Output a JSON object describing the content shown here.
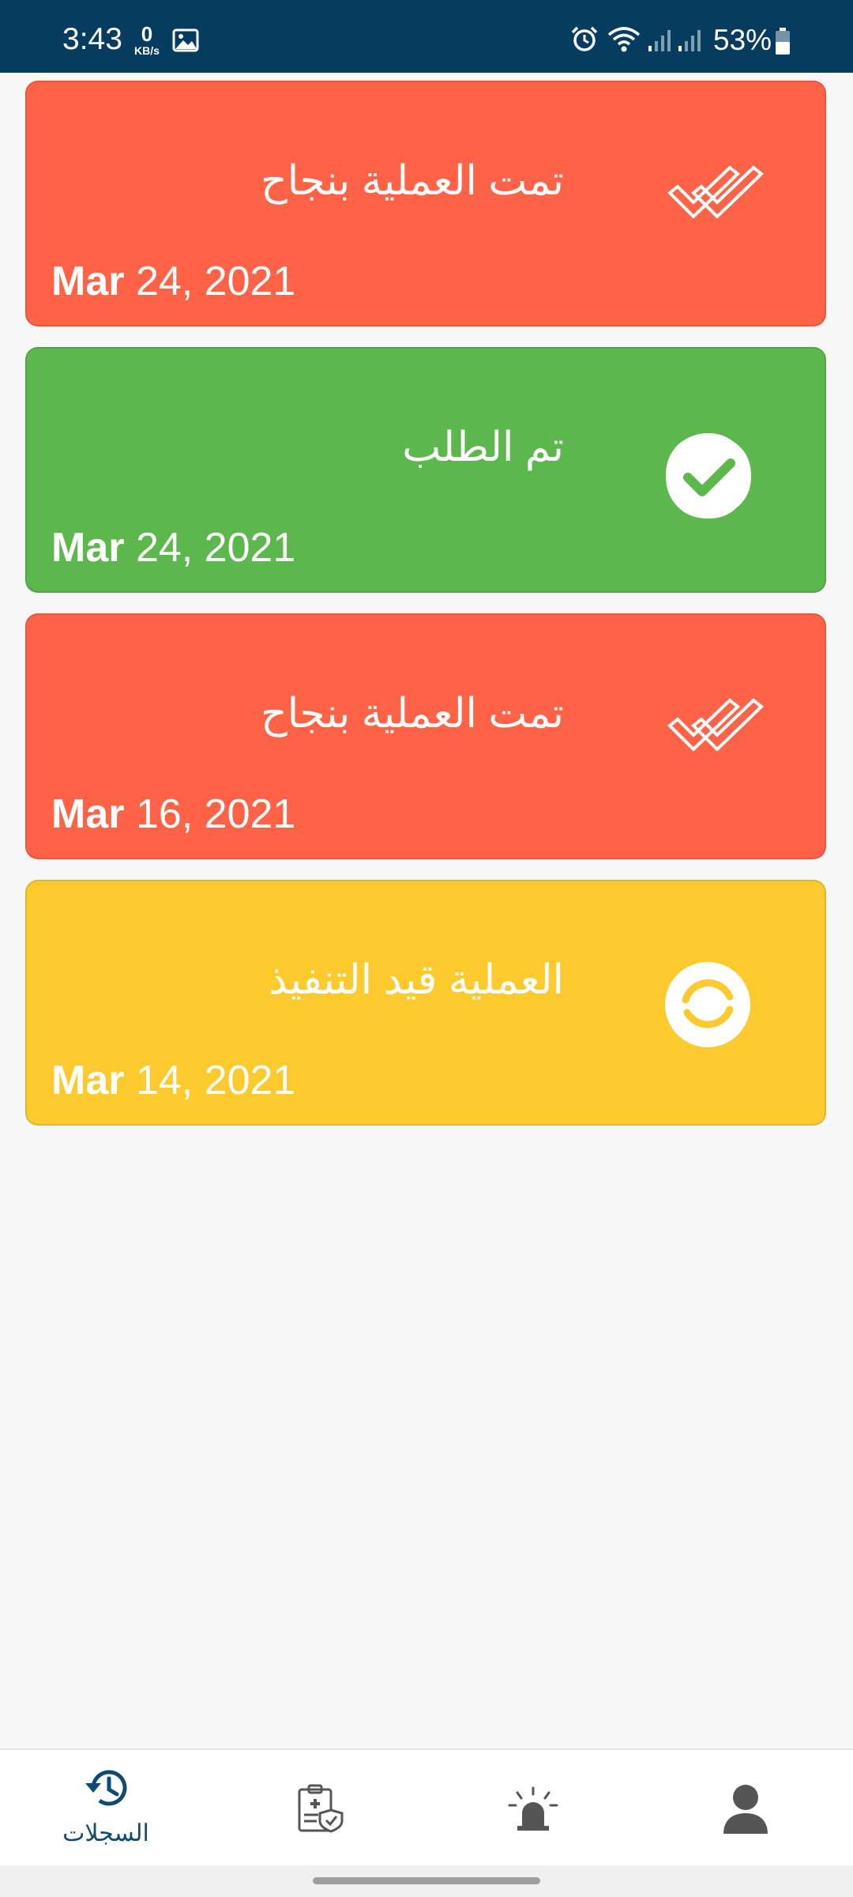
{
  "status_bar": {
    "time": "3:43",
    "net_speed_value": "0",
    "net_speed_unit": "KB/s",
    "battery": "53%"
  },
  "records": [
    {
      "title": "تمت العملية بنجاح",
      "month": "Mar",
      "day_year": "24, 2021",
      "color": "#ff6347",
      "icon": "double-check-icon"
    },
    {
      "title": "تم الطلب",
      "month": "Mar",
      "day_year": "24, 2021",
      "color": "#5cb84c",
      "icon": "check-badge-icon"
    },
    {
      "title": "تمت العملية بنجاح",
      "month": "Mar",
      "day_year": "16, 2021",
      "color": "#ff6347",
      "icon": "double-check-icon"
    },
    {
      "title": "العملية قيد التنفيذ",
      "month": "Mar",
      "day_year": "14, 2021",
      "color": "#fdca2d",
      "icon": "in-progress-icon"
    }
  ],
  "bottom_nav": {
    "items": [
      {
        "label": "السجلات",
        "icon": "history-icon",
        "active": true
      },
      {
        "label": "",
        "icon": "medical-report-icon",
        "active": false
      },
      {
        "label": "",
        "icon": "alarm-siren-icon",
        "active": false
      },
      {
        "label": "",
        "icon": "profile-icon",
        "active": false
      }
    ],
    "active_color": "#0f4a73",
    "inactive_color": "#555555"
  }
}
